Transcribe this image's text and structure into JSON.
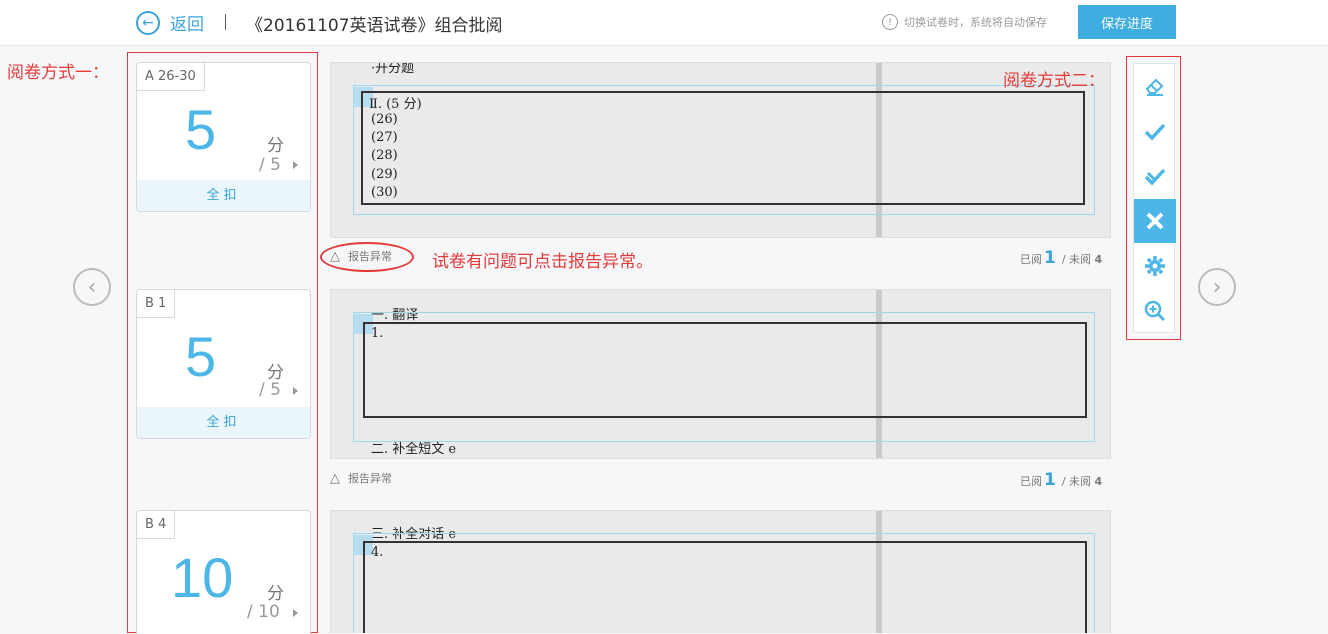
{
  "header": {
    "back_label": "返回",
    "title": "《20161107英语试卷》组合批阅",
    "hint": "切换试卷时，系统将自动保存",
    "save_label": "保存进度"
  },
  "annotations": {
    "method_one": "阅卷方式一：",
    "method_two": "阅卷方式二：",
    "report_hint": "试卷有问题可点击报告异常。"
  },
  "score_cards": [
    {
      "tag": "A 26-30",
      "score": "5",
      "unit": "分",
      "total": "/ 5",
      "deduct": "全扣"
    },
    {
      "tag": "B 1",
      "score": "5",
      "unit": "分",
      "total": "/ 5",
      "deduct": "全扣"
    },
    {
      "tag": "B 4",
      "score": "10",
      "unit": "分",
      "total": "/ 10"
    }
  ],
  "sheets": [
    {
      "heading": "·开分题",
      "lines": [
        "Ⅱ. (5 分)",
        "(26)",
        "(27)",
        "(28)",
        "(29)",
        "(30)"
      ]
    },
    {
      "heading": "一. 翻译",
      "lines": [
        "1."
      ],
      "footer": "二. 补全短文 e"
    },
    {
      "heading": "三. 补全对话 e",
      "lines": [
        "4."
      ]
    }
  ],
  "report_label": "报告异常",
  "read_status": [
    {
      "read_label": "已阅",
      "read": "1",
      "unread_label": "/ 未阅",
      "unread": "4"
    },
    {
      "read_label": "已阅",
      "read": "1",
      "unread_label": "/ 未阅",
      "unread": "4"
    }
  ],
  "tools": [
    "eraser-icon",
    "check-icon",
    "half-check-icon",
    "cross-icon",
    "settings-icon",
    "zoom-in-icon"
  ],
  "colors": {
    "accent": "#3aa3d8",
    "annotation_red": "#e53a3a"
  }
}
